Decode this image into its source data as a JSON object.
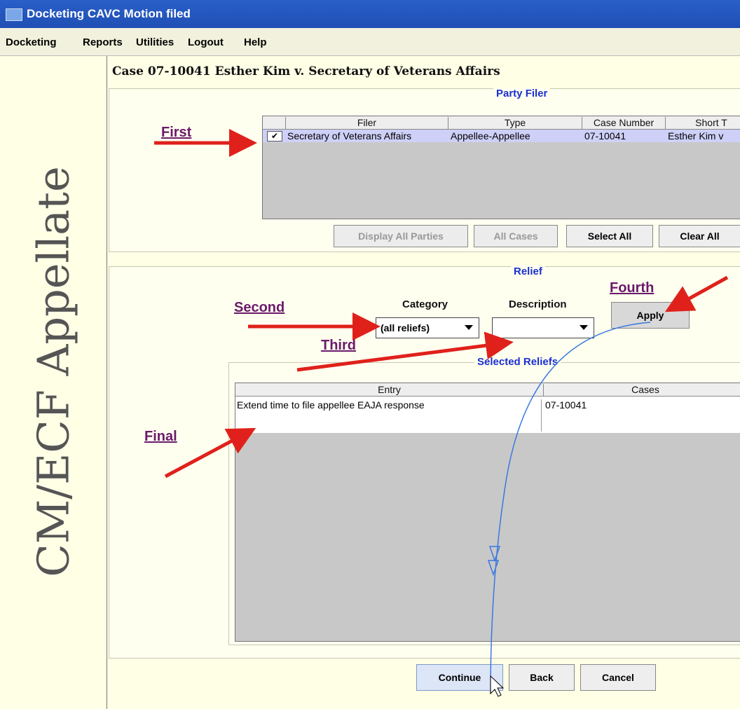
{
  "window": {
    "title": "Docketing CAVC Motion filed"
  },
  "menu": [
    "Docketing",
    "Reports",
    "Utilities",
    "Logout",
    "Help"
  ],
  "sidebar": {
    "brand": "CM/ECF Appellate"
  },
  "case_title": "Case 07-10041 Esther Kim v. Secretary of Veterans Affairs",
  "party_filer": {
    "title": "Party Filer",
    "columns": [
      "Filer",
      "Type",
      "Case Number",
      "Short T"
    ],
    "rows": [
      {
        "checked": true,
        "filer": "Secretary of Veterans Affairs",
        "type": "Appellee-Appellee",
        "case_number": "07-10041",
        "short_title": "Esther Kim v"
      }
    ],
    "buttons": {
      "display_all": "Display All Parties",
      "all_cases": "All Cases",
      "select_all": "Select All",
      "clear_all": "Clear All"
    }
  },
  "relief": {
    "title": "Relief",
    "category_label": "Category",
    "description_label": "Description",
    "category_value": "(all reliefs)",
    "description_value": "",
    "apply_label": "Apply",
    "selected_title": "Selected Reliefs",
    "columns": [
      "Entry",
      "Cases"
    ],
    "rows": [
      {
        "entry": "Extend time to file appellee EAJA response",
        "cases": "07-10041"
      }
    ]
  },
  "bottom_buttons": {
    "continue": "Continue",
    "back": "Back",
    "cancel": "Cancel"
  },
  "annotations": {
    "first": "First",
    "second": "Second",
    "third": "Third",
    "fourth": "Fourth",
    "final": "Final"
  },
  "colors": {
    "background": "#ffffe6",
    "titlebar": "#2a5fc9",
    "panel_title": "#1a2fd0",
    "annotation": "#6a1a6a",
    "arrow": "#e0211b",
    "selected_row": "#cfd0f8"
  }
}
